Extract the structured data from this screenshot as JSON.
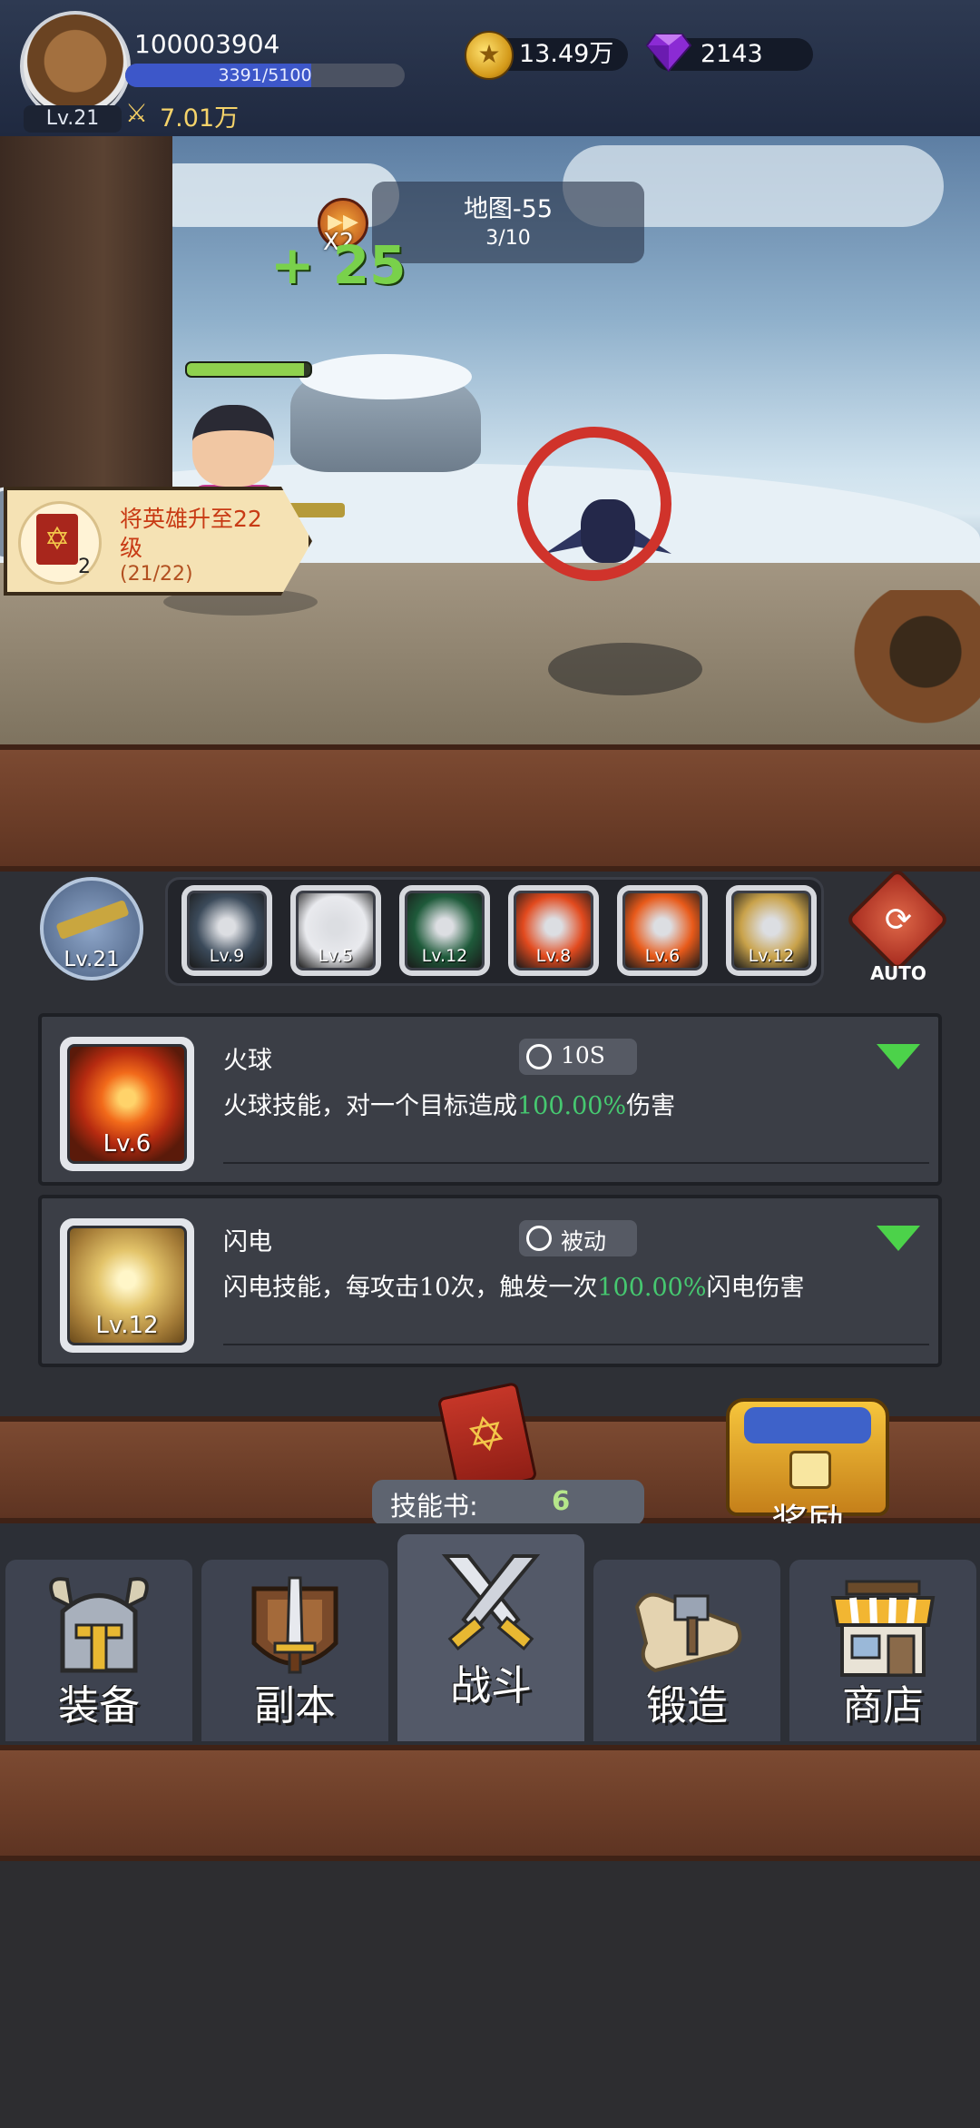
{
  "player": {
    "id": "100003904",
    "level": "Lv.21",
    "exp_text": "3391/5100",
    "exp_progress": 0.665,
    "power": "7.01万",
    "avatar": "bear-avatar"
  },
  "resources": {
    "gold": "13.49万",
    "gems": "2143",
    "gold_icon": "gold-coin-icon",
    "gem_icon": "purple-diamond-icon"
  },
  "battle": {
    "map_name": "地图-55",
    "wave": "3/10",
    "speed_label": "X2",
    "damage_popup": "+ 25",
    "hero_hp_fraction": 0.95
  },
  "quest": {
    "text": "将英雄升至22级",
    "progress": "(21/22)",
    "reward_count": "2",
    "icon": "skill-book-icon"
  },
  "weapon": {
    "level": "Lv.21",
    "icon": "rifle-icon"
  },
  "skill_slots": [
    {
      "level": "Lv.9",
      "icon": "shield-skill-icon",
      "color": "#3b4a5a"
    },
    {
      "level": "Lv.5",
      "icon": "skull-bomb-icon",
      "color": "#e9eaee"
    },
    {
      "level": "Lv.12",
      "icon": "green-ring-icon",
      "color": "#1e5a3a"
    },
    {
      "level": "Lv.8",
      "icon": "fire-creature-icon",
      "color": "#e24a1e"
    },
    {
      "level": "Lv.6",
      "icon": "fireball-icon",
      "color": "#e85a1a"
    },
    {
      "level": "Lv.12",
      "icon": "lightning-icon",
      "color": "#c9a24a"
    }
  ],
  "auto_label": "AUTO",
  "skills": [
    {
      "name": "火球",
      "cooldown": "10S",
      "level": "Lv.6",
      "desc_prefix": "火球技能，对一个目标造成",
      "desc_highlight": "100.00%",
      "desc_suffix": "伤害",
      "icon": "fireball-icon"
    },
    {
      "name": "闪电",
      "cooldown": "被动",
      "level": "Lv.12",
      "desc_prefix": "闪电技能，每攻击10次，触发一次",
      "desc_highlight": "100.00%",
      "desc_suffix": "闪电伤害",
      "icon": "lightning-icon"
    }
  ],
  "skill_book": {
    "label": "技能书:",
    "count": "6"
  },
  "reward_label": "奖励",
  "nav": [
    {
      "label": "装备",
      "icon": "viking-helmet-icon"
    },
    {
      "label": "副本",
      "icon": "sword-shield-icon"
    },
    {
      "label": "战斗",
      "icon": "crossed-swords-icon"
    },
    {
      "label": "锻造",
      "icon": "hammer-scroll-icon"
    },
    {
      "label": "商店",
      "icon": "shop-icon"
    }
  ]
}
